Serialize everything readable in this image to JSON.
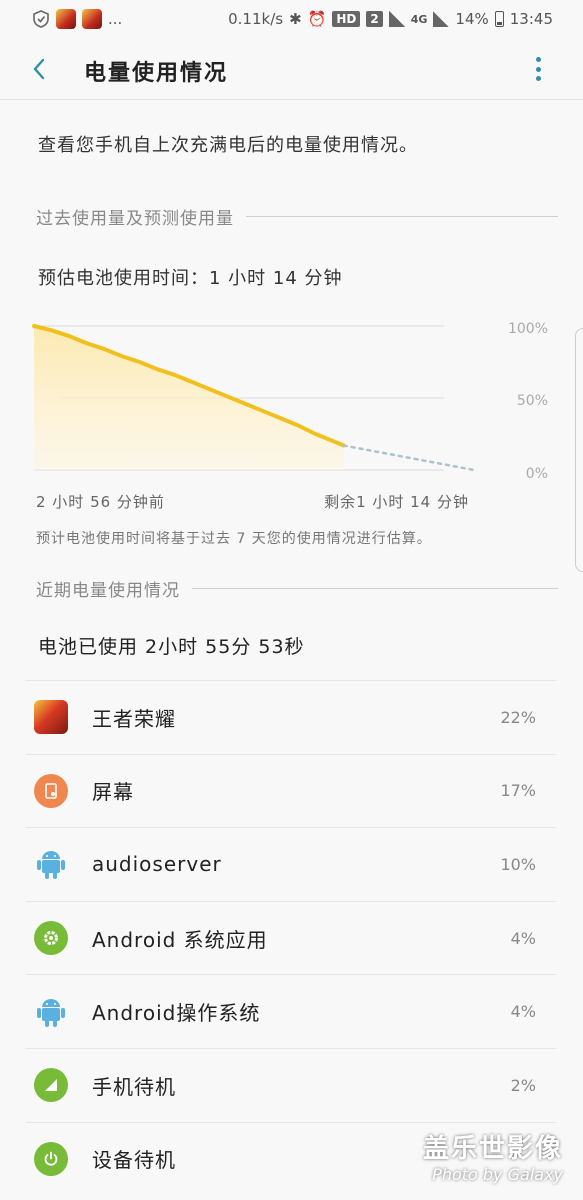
{
  "status_bar": {
    "speed": "0.11k/s",
    "hd": "HD",
    "sim": "2",
    "network": "4G",
    "battery": "14%",
    "time": "13:45",
    "ellipsis": "..."
  },
  "app_bar": {
    "title": "电量使用情况"
  },
  "description": "查看您手机自上次充满电后的电量使用情况。",
  "section_past": "过去使用量及预测使用量",
  "estimate": "预估电池使用时间：1 小时 14 分钟",
  "chart_data": {
    "type": "area",
    "y_ticks": [
      "100%",
      "50%",
      "0%"
    ],
    "ylim": [
      0,
      100
    ],
    "x_start_label": "2 小时 56 分钟前",
    "x_end_label": "剩余1 小时 14 分钟",
    "series": [
      {
        "x": [
          0,
          10,
          20,
          30,
          40,
          50,
          60,
          70,
          80,
          90,
          100,
          110,
          120,
          130,
          140,
          150,
          160,
          170,
          176
        ],
        "values": [
          100,
          97,
          93,
          88,
          84,
          79,
          75,
          70,
          66,
          61,
          56,
          51,
          46,
          41,
          36,
          31,
          25,
          20,
          17
        ]
      },
      {
        "x": [
          176,
          250
        ],
        "values": [
          17,
          0
        ]
      }
    ],
    "colors": {
      "actual": "#f2c01e",
      "predicted": "#a9c4cc",
      "fill": "#fdf1cc",
      "grid": "#dddddd"
    }
  },
  "chart_footnote": "预计电池使用时间将基于过去 7 天您的使用情况进行估算。",
  "section_recent": "近期电量使用情况",
  "battery_used": "电池已使用 2小时 55分 53秒",
  "apps": [
    {
      "name": "王者荣耀",
      "percent": "22%",
      "icon": "game-icon"
    },
    {
      "name": "屏幕",
      "percent": "17%",
      "icon": "screen-icon"
    },
    {
      "name": "audioserver",
      "percent": "10%",
      "icon": "android-icon"
    },
    {
      "name": "Android 系统应用",
      "percent": "4%",
      "icon": "gear-icon"
    },
    {
      "name": "Android操作系统",
      "percent": "4%",
      "icon": "android-icon"
    },
    {
      "name": "手机待机",
      "percent": "2%",
      "icon": "signal-icon"
    },
    {
      "name": "设备待机",
      "percent": "",
      "icon": "power-icon"
    }
  ],
  "watermark": {
    "line1": "盖乐世影像",
    "line2": "Photo by Galaxy"
  }
}
